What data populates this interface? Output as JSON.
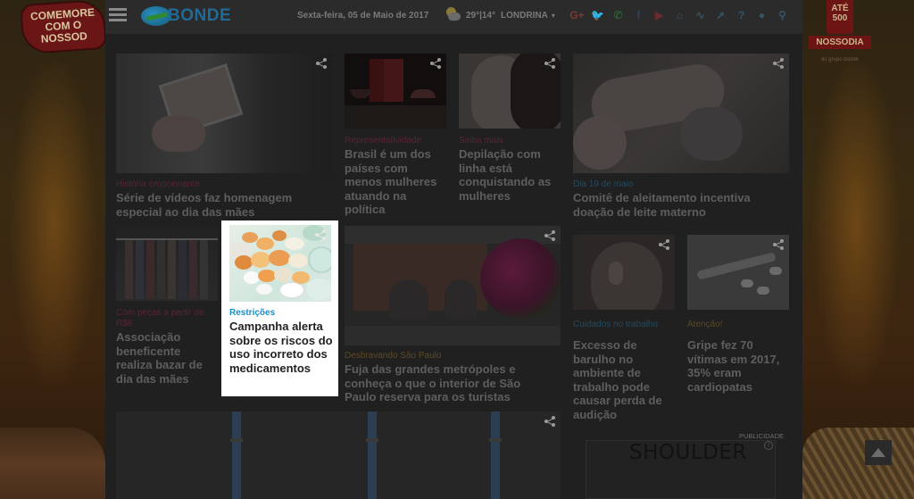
{
  "header": {
    "logo_text": "BONDE",
    "date": "Sexta-feira, 05 de Maio de 2017",
    "weather_temp": "29°|14°",
    "weather_city": "LONDRINA",
    "social_icons": [
      "google-plus-icon",
      "twitter-icon",
      "whatsapp-icon",
      "facebook-icon",
      "youtube-icon",
      "home-icon",
      "rss-icon",
      "pin-icon",
      "help-icon",
      "user-icon",
      "search-icon"
    ]
  },
  "ads": {
    "left_promo": "COMEMORE COM O NOSSOD",
    "right_promo_top": "ATÉ 500",
    "right_promo_brand": "NOSSODIA",
    "right_promo_tag": "do grupo bonde",
    "publicidade_label": "PUBLICIDADE",
    "ad_text": "SHOULDER",
    "ad_info": "i"
  },
  "cards": [
    {
      "category": "História emocionante",
      "title": "Série de vídeos faz homenagem especial ao dia das mães"
    },
    {
      "category": "Representatividade",
      "title": "Brasil é um dos países com menos mulheres atuando na política"
    },
    {
      "category": "Saiba mais",
      "title": "Depilação com linha está conquistando as mulheres"
    },
    {
      "category": "Dia 19 de maio",
      "title": "Comitê de aleitamento incentiva doação de leite materno"
    },
    {
      "category": "Com peças a partir de R$8",
      "title": "Associação beneficente realiza bazar de dia das mães"
    },
    {
      "category": "Restrições",
      "title": "Campanha alerta sobre os riscos do uso incorreto dos medicamentos"
    },
    {
      "category": "Desbravando São Paulo",
      "title": "Fuja das grandes metrópoles e conheça o que o interior de São Paulo reserva para os turistas"
    },
    {
      "category": "Cuidados no trabalho",
      "title": "Excesso de barulho no ambiente de trabalho pode causar perda de audição"
    },
    {
      "category": "Atenção!",
      "title": "Gripe fez 70 vítimas em 2017, 35% eram cardiopatas"
    }
  ],
  "colors": {
    "focus_category": "#1a8fc6",
    "overlay_bg": "#202020",
    "pink_category": "#5a2333",
    "blue_category": "#244a5e"
  }
}
